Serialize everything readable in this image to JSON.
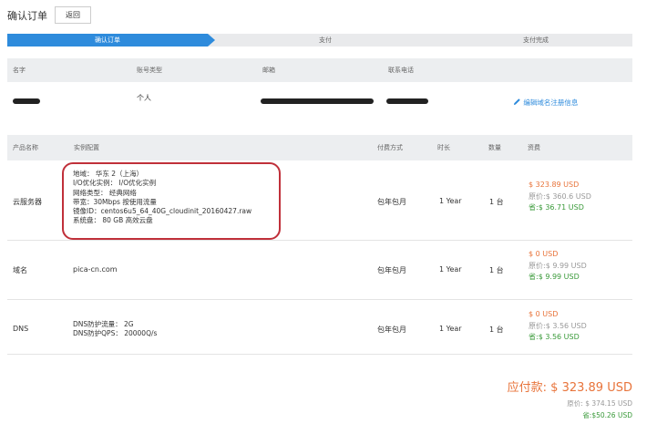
{
  "header": {
    "title": "确认订单",
    "back_label": "返回"
  },
  "steps": [
    "确认订单",
    "支付",
    "支付完成"
  ],
  "user_table": {
    "columns": [
      "名字",
      "账号类型",
      "邮箱",
      "联系电话"
    ],
    "row": {
      "account_type": "个人",
      "edit_label": "编辑域名注册信息"
    }
  },
  "product_table": {
    "columns": [
      "产品名称",
      "实例配置",
      "付费方式",
      "时长",
      "数量",
      "资费"
    ],
    "rows": [
      {
        "name": "云服务器",
        "config": [
          "地域： 华东 2（上海）",
          "I/O优化实例： I/O优化实例",
          "网络类型： 经典网络",
          "带宽：30Mbps 按使用流量",
          "镜像ID：centos6u5_64_40G_cloudinit_20160427.raw",
          "系统盘： 80 GB 高效云盘"
        ],
        "pay_method": "包年包月",
        "duration": "1 Year",
        "quantity": "1 台",
        "price": "$ 323.89 USD",
        "original": "原价:$ 360.6 USD",
        "saved": "省:$ 36.71 USD"
      },
      {
        "name": "域名",
        "config": [
          "pica-cn.com"
        ],
        "pay_method": "包年包月",
        "duration": "1 Year",
        "quantity": "1 台",
        "price": "$ 0 USD",
        "original": "原价:$ 9.99 USD",
        "saved": "省:$ 9.99 USD"
      },
      {
        "name": "DNS",
        "config": [
          "DNS防护流量： 2G",
          "DNS防护QPS： 20000Q/s"
        ],
        "pay_method": "包年包月",
        "duration": "1 Year",
        "quantity": "1 台",
        "price": "$ 0 USD",
        "original": "原价:$ 3.56 USD",
        "saved": "省:$ 3.56 USD"
      }
    ]
  },
  "summary": {
    "total": "应付款: $ 323.89 USD",
    "original": "原价: $ 374.15 USD",
    "saved": "省:$50.26 USD"
  },
  "colors": {
    "accent": "#2e8bdc",
    "price": "#e8743b",
    "saved": "#3a9a3a",
    "highlight": "#c0303a"
  }
}
